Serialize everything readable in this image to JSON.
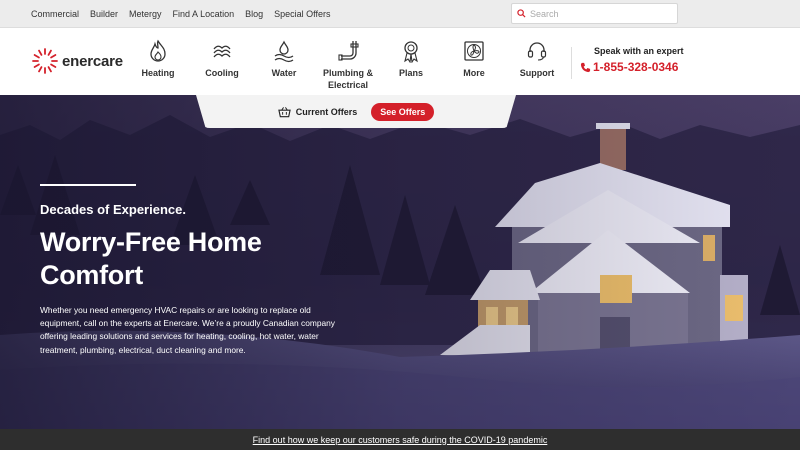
{
  "utility": {
    "links": [
      "Commercial",
      "Builder",
      "Metergy",
      "Find A Location",
      "Blog",
      "Special Offers"
    ],
    "search_placeholder": "Search"
  },
  "brand": {
    "name": "enercare",
    "color": "#d4202a"
  },
  "nav": {
    "items": [
      {
        "label": "Heating",
        "icon": "flame-icon"
      },
      {
        "label": "Cooling",
        "icon": "snowflake-icon"
      },
      {
        "label": "Water",
        "icon": "water-drop-icon"
      },
      {
        "label": "Plumbing & Electrical",
        "icon": "pipe-icon"
      },
      {
        "label": "Plans",
        "icon": "ribbon-icon"
      },
      {
        "label": "More",
        "icon": "fan-icon"
      },
      {
        "label": "Support",
        "icon": "headset-icon"
      }
    ]
  },
  "contact": {
    "speak_label": "Speak with an expert",
    "phone": "1-855-328-0346"
  },
  "offers": {
    "label": "Current Offers",
    "button": "See Offers"
  },
  "hero": {
    "eyebrow": "Decades of Experience.",
    "headline": "Worry-Free Home Comfort",
    "body": "Whether you need emergency HVAC repairs or are looking to replace old equipment, call on the experts at Enercare. We’re a proudly Canadian company offering leading solutions and services for heating, cooling, hot water, water treatment, plumbing, electrical, duct cleaning and more."
  },
  "banner": {
    "text": "Find out how we keep our customers safe during the COVID-19 pandemic"
  }
}
